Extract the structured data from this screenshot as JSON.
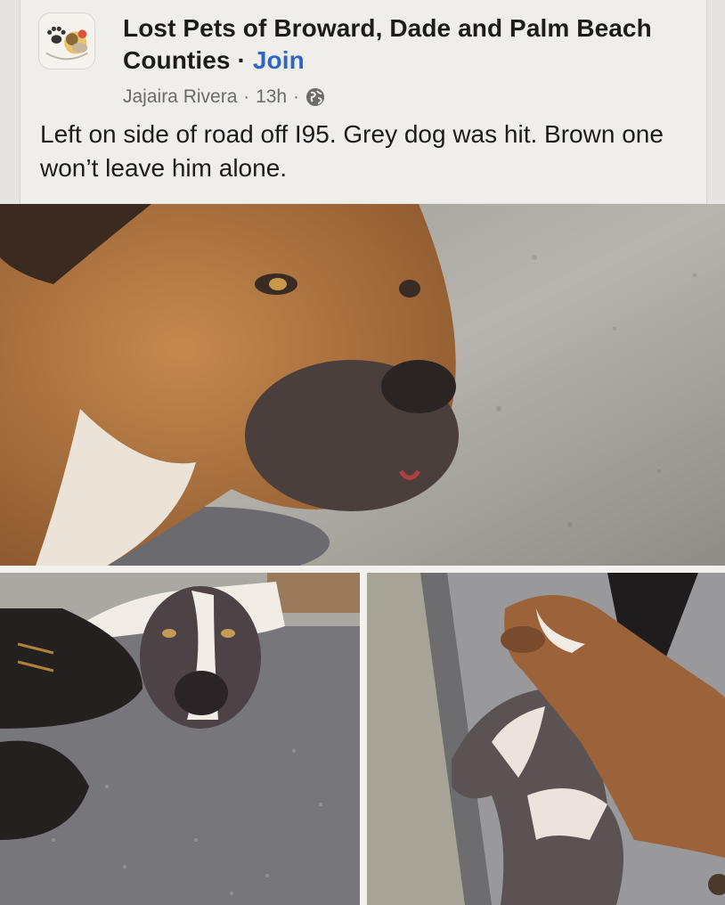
{
  "post": {
    "group_name": "Lost Pets of  Broward, Dade and Palm Beach Counties",
    "separator": "·",
    "join_label": "Join",
    "author": "Jajaira Rivera",
    "time": "13h",
    "privacy_icon": "globe-icon",
    "text": "Left on side of road off I95. Grey dog was hit. Brown one won’t leave him alone."
  },
  "photos": [
    {
      "name": "brown-dog-closeup-photo"
    },
    {
      "name": "grey-dog-lying-photo"
    },
    {
      "name": "two-dogs-curb-photo"
    }
  ],
  "colors": {
    "link": "#2f67c7",
    "text": "#1c1c1c",
    "meta": "#6d6b68"
  }
}
